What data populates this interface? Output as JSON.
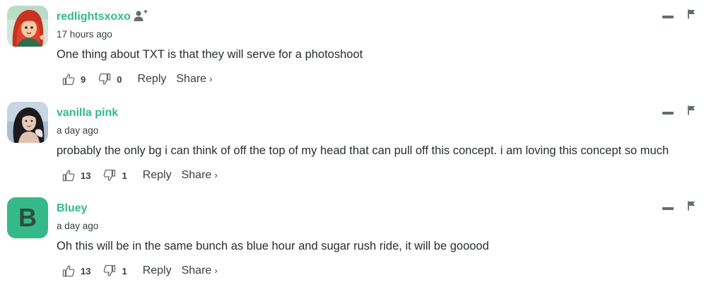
{
  "comments": [
    {
      "username": "redlightsxoxo",
      "timestamp": "17 hours ago",
      "text": "One thing about TXT is that they will serve for a photoshoot",
      "upvotes": "9",
      "downvotes": "0",
      "reply_label": "Reply",
      "share_label": "Share",
      "share_chevron": "›",
      "avatar_icon": "cartoon-red-hair-avatar",
      "has_follow_icon": true
    },
    {
      "username": "vanilla pink",
      "timestamp": "a day ago",
      "text": "probably the only bg i can think of off the top of my head that can pull off this concept. i am loving this concept so much",
      "upvotes": "13",
      "downvotes": "1",
      "reply_label": "Reply",
      "share_label": "Share",
      "share_chevron": "›",
      "avatar_icon": "photo-avatar"
    },
    {
      "username": "Bluey",
      "timestamp": "a day ago",
      "text": "Oh this will be in the same bunch as blue hour and sugar rush ride, it will be gooood",
      "upvotes": "13",
      "downvotes": "1",
      "reply_label": "Reply",
      "share_label": "Share",
      "share_chevron": "›",
      "avatar_letter": "B",
      "avatar_color": "#35b98a"
    }
  ],
  "colors": {
    "username": "#35b98a",
    "text": "#2a2e2e",
    "muted": "#3a3f3f",
    "icon": "#656c6c"
  }
}
